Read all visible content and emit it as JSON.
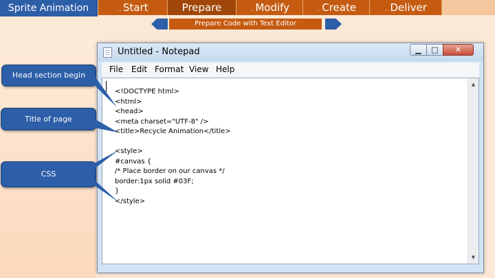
{
  "header": {
    "title": "Sprite Animation",
    "tabs": [
      {
        "label": "Start"
      },
      {
        "label": "Prepare"
      },
      {
        "label": "Modify"
      },
      {
        "label": "Create"
      },
      {
        "label": "Deliver"
      }
    ],
    "dots": "..",
    "subtitle": "Prepare Code with Text Editor"
  },
  "callouts": [
    {
      "label": "Head section begin"
    },
    {
      "label": "Title of page"
    },
    {
      "label": "CSS"
    }
  ],
  "notepad": {
    "title": "Untitled - Notepad",
    "window_buttons": {
      "minimize": "▁",
      "maximize": "□",
      "close": "✕"
    },
    "menu": [
      "File",
      "Edit",
      "Format",
      "View",
      "Help"
    ],
    "code_lines": [
      "<!DOCTYPE html>",
      "<html>",
      "<head>",
      "<meta charset=\"UTF-8\" />",
      "<title>Recycle Animation</title>",
      "",
      "<style>",
      "#canvas {",
      "/* Place border on our canvas */",
      "border:1px solid #03F;",
      "}",
      "</style>"
    ],
    "scroll": {
      "up": "▲",
      "down": "▼"
    }
  },
  "colors": {
    "nav_orange": "#c55b11",
    "nav_blue": "#2d5ea8",
    "background": "#fce8d6",
    "connector": "#2d5ea8"
  }
}
